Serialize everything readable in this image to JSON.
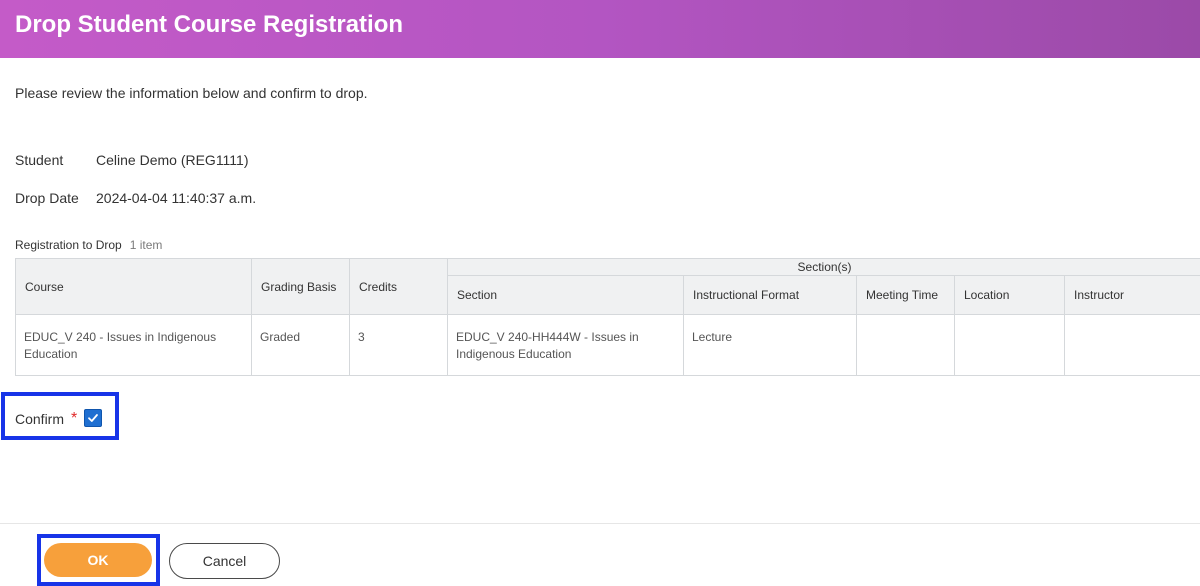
{
  "header": {
    "title": "Drop Student Course Registration"
  },
  "intro": "Please review the information below and confirm to drop.",
  "fields": [
    {
      "label": "Student",
      "value": "Celine Demo (REG1111)"
    },
    {
      "label": "Drop Date",
      "value": "2024-04-04 11:40:37 a.m."
    }
  ],
  "grid": {
    "title": "Registration to Drop",
    "count": "1 item",
    "group_header": "Section(s)",
    "columns": [
      "Course",
      "Grading Basis",
      "Credits",
      "Section",
      "Instructional Format",
      "Meeting Time",
      "Location",
      "Instructor"
    ],
    "rows": [
      {
        "course": "EDUC_V 240 - Issues in Indigenous Education",
        "grading_basis": "Graded",
        "credits": "3",
        "section": "EDUC_V 240-HH444W - Issues in Indigenous Education",
        "instructional_format": "Lecture",
        "meeting_time": "",
        "location": "",
        "instructor": ""
      }
    ]
  },
  "confirm": {
    "label": "Confirm",
    "required_mark": "*",
    "checked": true
  },
  "buttons": {
    "ok": "OK",
    "cancel": "Cancel"
  },
  "colors": {
    "header_start": "#c45bc8",
    "header_end": "#9b4aa8",
    "ok_button": "#f7a03b",
    "checkbox": "#1f6fd1",
    "highlight": "#1734e8",
    "required": "#e02b2b"
  }
}
